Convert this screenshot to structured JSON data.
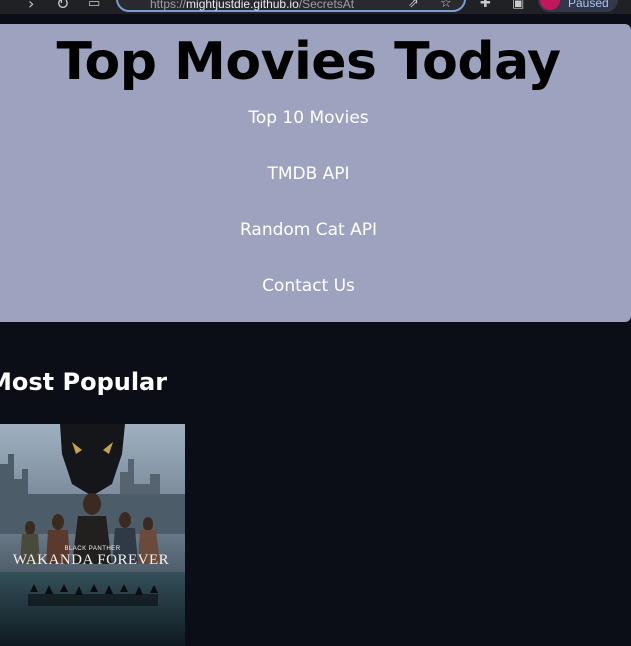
{
  "browser": {
    "url_scheme": "https://",
    "url_host": "mightjustdie.github.io",
    "url_path": "/SecretsAt",
    "profile_label": "Paused"
  },
  "header": {
    "title": "Top Movies Today",
    "nav": [
      {
        "label": "Top 10 Movies"
      },
      {
        "label": "TMDB API"
      },
      {
        "label": "Random Cat API"
      },
      {
        "label": "Contact Us"
      }
    ]
  },
  "main": {
    "section_title": "Most Popular",
    "movies": [
      {
        "poster_kicker": "BLACK PANTHER",
        "poster_title": "WAKANDA FOREVER"
      }
    ]
  },
  "colors": {
    "header_bg": "#9da3bf",
    "page_bg": "#0b0e17",
    "title_text": "#000000",
    "nav_text": "#ffffff"
  },
  "icons": [
    "back-icon",
    "reload-icon",
    "bookmark-icon",
    "share-icon",
    "star-icon",
    "extensions-icon",
    "sidepanel-icon"
  ]
}
